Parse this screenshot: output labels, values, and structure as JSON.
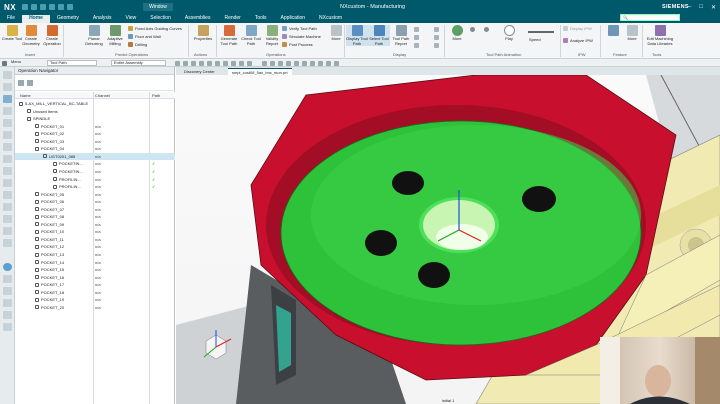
{
  "titlebar": {
    "logo": "NX",
    "window_menu": "Window",
    "app_title": "NXcustom - Manufacturing",
    "brand": "SIEMENS"
  },
  "menu_tabs": [
    "File",
    "Home",
    "Geometry",
    "Analysis",
    "View",
    "Selection",
    "Assemblies",
    "Render",
    "Tools",
    "Application",
    "NXcustom"
  ],
  "active_tab": "Home",
  "ribbon": {
    "insert": {
      "create_tool": "Create Tool",
      "create_geometry": "Create Geometry",
      "create_operation": "Create Operation",
      "label": "Insert"
    },
    "predict": {
      "planar_deburring": "Planar Deburring",
      "adaptive_milling": "Adaptive Milling",
      "fixed_axis_guiding_curves": "Fixed Axis Guiding Curves",
      "floor_and_wall": "Floor and Wall",
      "drilling": "Drilling",
      "label": "Predict Operations"
    },
    "actions": {
      "properties": "Properties",
      "label": "Actions"
    },
    "operations": {
      "generate_tool_path": "Generate Tool Path",
      "check_tool_path": "Check Tool Path",
      "validity_report": "Validity Report",
      "verify_tool_path": "Verify Tool Path",
      "simulate_machine": "Simulate Machine",
      "post_process": "Post Process",
      "more": "More",
      "label": "Operations"
    },
    "display": {
      "display_tool_path": "Display Tool Path",
      "select_tool_path": "Select Tool Path",
      "tool_path_report": "Tool Path Report",
      "label": "Display"
    },
    "animation": {
      "more": "More",
      "play": "Play",
      "speed": "Speed",
      "label": "Tool Path Animation"
    },
    "ipw": {
      "display_ipw": "Display IPW",
      "analyze_ipw": "Analyze IPW",
      "label": "IPW"
    },
    "feature": {
      "more": "More",
      "label": "Feature"
    },
    "tools": {
      "edit_machining_data_libraries": "Edit Machining Data Libraries",
      "label": "Tools"
    }
  },
  "toolbar2": {
    "menu": "Menu",
    "filter": "Tool Path",
    "scope": "Entire Assembly"
  },
  "navigator": {
    "title": "Operation Navigator",
    "columns": {
      "name": "Name",
      "channel": "Channel",
      "path": "Path"
    },
    "rows": [
      {
        "label": "5-AX_MILL_VERTICAL_BC-TABLE",
        "channel": "",
        "check": "",
        "indent": 2,
        "sel": false
      },
      {
        "label": "Unused Items",
        "channel": "",
        "check": "",
        "indent": 10,
        "sel": false
      },
      {
        "label": "SPINDLE",
        "channel": "",
        "check": "",
        "indent": 10,
        "sel": false
      },
      {
        "label": "POCKET_01",
        "channel": "n/a",
        "check": "",
        "indent": 18,
        "sel": false
      },
      {
        "label": "POCKET_02",
        "channel": "n/a",
        "check": "",
        "indent": 18,
        "sel": false
      },
      {
        "label": "POCKET_03",
        "channel": "n/a",
        "check": "",
        "indent": 18,
        "sel": false
      },
      {
        "label": "POCKET_04",
        "channel": "n/a",
        "check": "",
        "indent": 18,
        "sel": false
      },
      {
        "label": "UGT0201_085",
        "channel": "n/a",
        "check": "",
        "indent": 26,
        "sel": true
      },
      {
        "label": "POCKETIN...",
        "channel": "n/a",
        "check": "✓",
        "indent": 36,
        "sel": false
      },
      {
        "label": "POCKETIN...",
        "channel": "n/a",
        "check": "✓",
        "indent": 36,
        "sel": false
      },
      {
        "label": "PROFILIN...",
        "channel": "n/a",
        "check": "✓",
        "indent": 36,
        "sel": false
      },
      {
        "label": "PROFILIN...",
        "channel": "n/a",
        "check": "✓",
        "indent": 36,
        "sel": false
      },
      {
        "label": "POCKET_05",
        "channel": "n/a",
        "check": "",
        "indent": 18,
        "sel": false
      },
      {
        "label": "POCKET_06",
        "channel": "n/a",
        "check": "",
        "indent": 18,
        "sel": false
      },
      {
        "label": "POCKET_07",
        "channel": "n/a",
        "check": "",
        "indent": 18,
        "sel": false
      },
      {
        "label": "POCKET_08",
        "channel": "n/a",
        "check": "",
        "indent": 18,
        "sel": false
      },
      {
        "label": "POCKET_09",
        "channel": "n/a",
        "check": "",
        "indent": 18,
        "sel": false
      },
      {
        "label": "POCKET_10",
        "channel": "n/a",
        "check": "",
        "indent": 18,
        "sel": false
      },
      {
        "label": "POCKET_11",
        "channel": "n/a",
        "check": "",
        "indent": 18,
        "sel": false
      },
      {
        "label": "POCKET_12",
        "channel": "n/a",
        "check": "",
        "indent": 18,
        "sel": false
      },
      {
        "label": "POCKET_13",
        "channel": "n/a",
        "check": "",
        "indent": 18,
        "sel": false
      },
      {
        "label": "POCKET_14",
        "channel": "n/a",
        "check": "",
        "indent": 18,
        "sel": false
      },
      {
        "label": "POCKET_15",
        "channel": "n/a",
        "check": "",
        "indent": 18,
        "sel": false
      },
      {
        "label": "POCKET_16",
        "channel": "n/a",
        "check": "",
        "indent": 18,
        "sel": false
      },
      {
        "label": "POCKET_17",
        "channel": "n/a",
        "check": "",
        "indent": 18,
        "sel": false
      },
      {
        "label": "POCKET_18",
        "channel": "n/a",
        "check": "",
        "indent": 18,
        "sel": false
      },
      {
        "label": "POCKET_19",
        "channel": "n/a",
        "check": "",
        "indent": 18,
        "sel": false
      },
      {
        "label": "POCKET_20",
        "channel": "n/a",
        "check": "",
        "indent": 18,
        "sel": false
      }
    ]
  },
  "viewport_tabs": [
    "Discovery Center",
    "smpl_cost08_5ax_bnc_mon.prt"
  ],
  "status": "Initial 1",
  "colors": {
    "accent": "#00586b",
    "part_red": "#c8102e",
    "pocket_green": "#2ec23a",
    "fixture_yellow": "#f2ecb0"
  }
}
